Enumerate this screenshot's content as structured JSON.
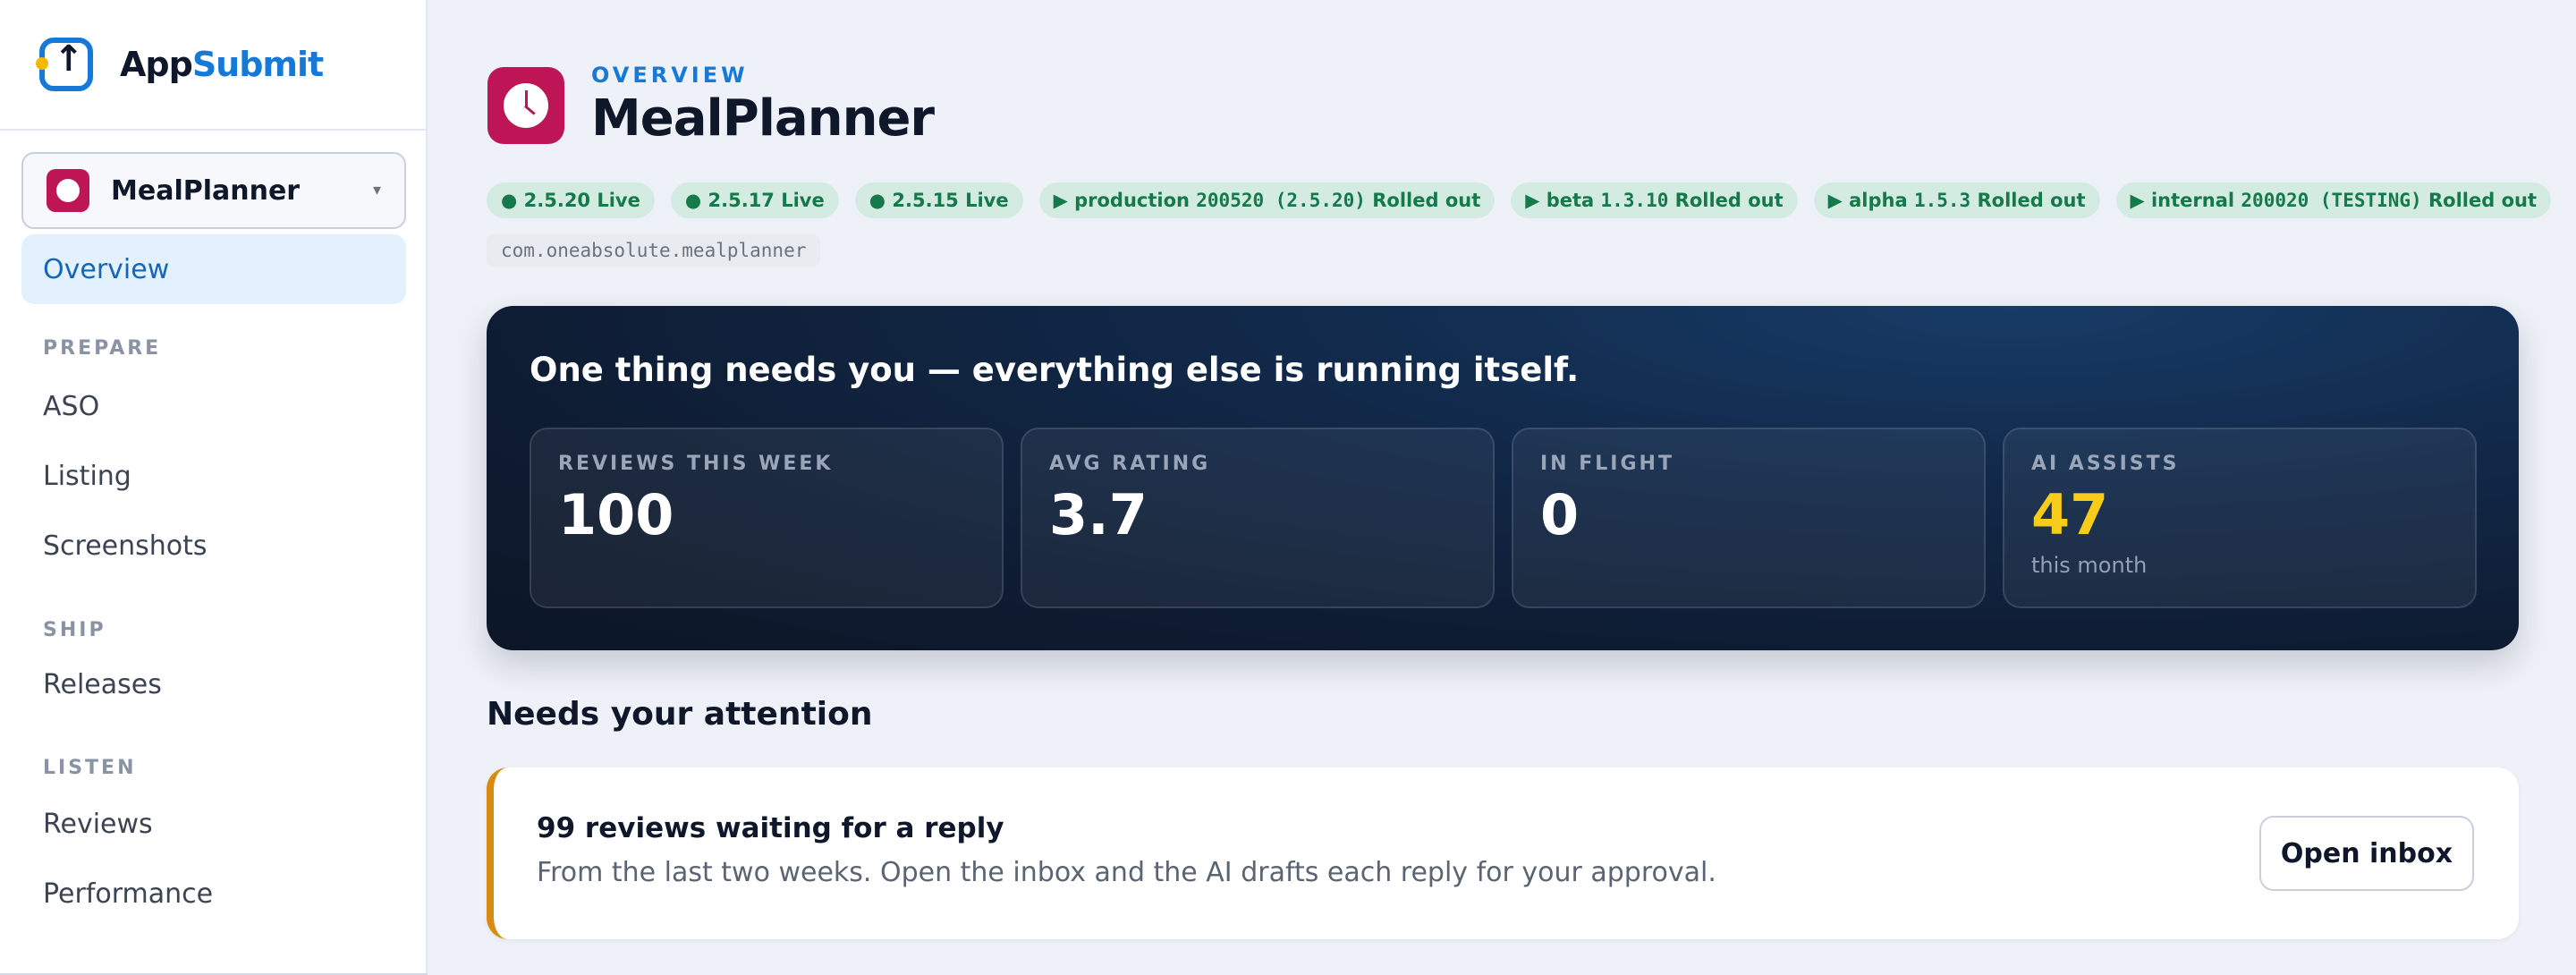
{
  "brand": {
    "name_part1": "App",
    "name_part2": "Submit",
    "logo_icon": "upload-arrow-icon"
  },
  "sidebar": {
    "app_selector": {
      "name": "MealPlanner",
      "caret": "▾"
    },
    "overview_label": "Overview",
    "groups": [
      {
        "label": "PREPARE",
        "items": [
          "ASO",
          "Listing",
          "Screenshots"
        ]
      },
      {
        "label": "SHIP",
        "items": [
          "Releases"
        ]
      },
      {
        "label": "LISTEN",
        "items": [
          "Reviews",
          "Performance"
        ]
      }
    ]
  },
  "header": {
    "eyebrow": "OVERVIEW",
    "title": "MealPlanner"
  },
  "chips": [
    {
      "icon": "apple-icon",
      "text": "2.5.20 Live"
    },
    {
      "icon": "apple-icon",
      "text": "2.5.17 Live"
    },
    {
      "icon": "apple-icon",
      "text": "2.5.15 Live"
    },
    {
      "icon": "play-icon",
      "pre": "production ",
      "mono": "200520 (2.5.20)",
      "post": " Rolled out"
    },
    {
      "icon": "play-icon",
      "pre": "beta ",
      "mono": "1.3.10",
      "post": " Rolled out"
    },
    {
      "icon": "play-icon",
      "pre": "alpha ",
      "mono": "1.5.3",
      "post": " Rolled out"
    },
    {
      "icon": "play-icon",
      "pre": "internal ",
      "mono": "200020 (TESTING)",
      "post": " Rolled out"
    }
  ],
  "bundle_id": "com.oneabsolute.mealplanner",
  "hero": {
    "title": "One thing needs you — everything else is running itself.",
    "stats": [
      {
        "label": "REVIEWS THIS WEEK",
        "value": "100",
        "sub": ""
      },
      {
        "label": "AVG RATING",
        "value": "3.7",
        "sub": ""
      },
      {
        "label": "IN FLIGHT",
        "value": "0",
        "sub": ""
      },
      {
        "label": "AI ASSISTS",
        "value": "47",
        "sub": "this month"
      }
    ]
  },
  "attention": {
    "section_title": "Needs your attention",
    "title": "99 reviews waiting for a reply",
    "description": "From the last two weeks. Open the inbox and the AI drafts each reply for your approval.",
    "button_label": "Open inbox"
  },
  "colors": {
    "accent": "#1679d8",
    "app_icon": "#be1557",
    "chip_bg": "#d4ebe2",
    "chip_text": "#157a4a",
    "highlight_value": "#f7cc1b",
    "attention_border": "#d98a10"
  }
}
